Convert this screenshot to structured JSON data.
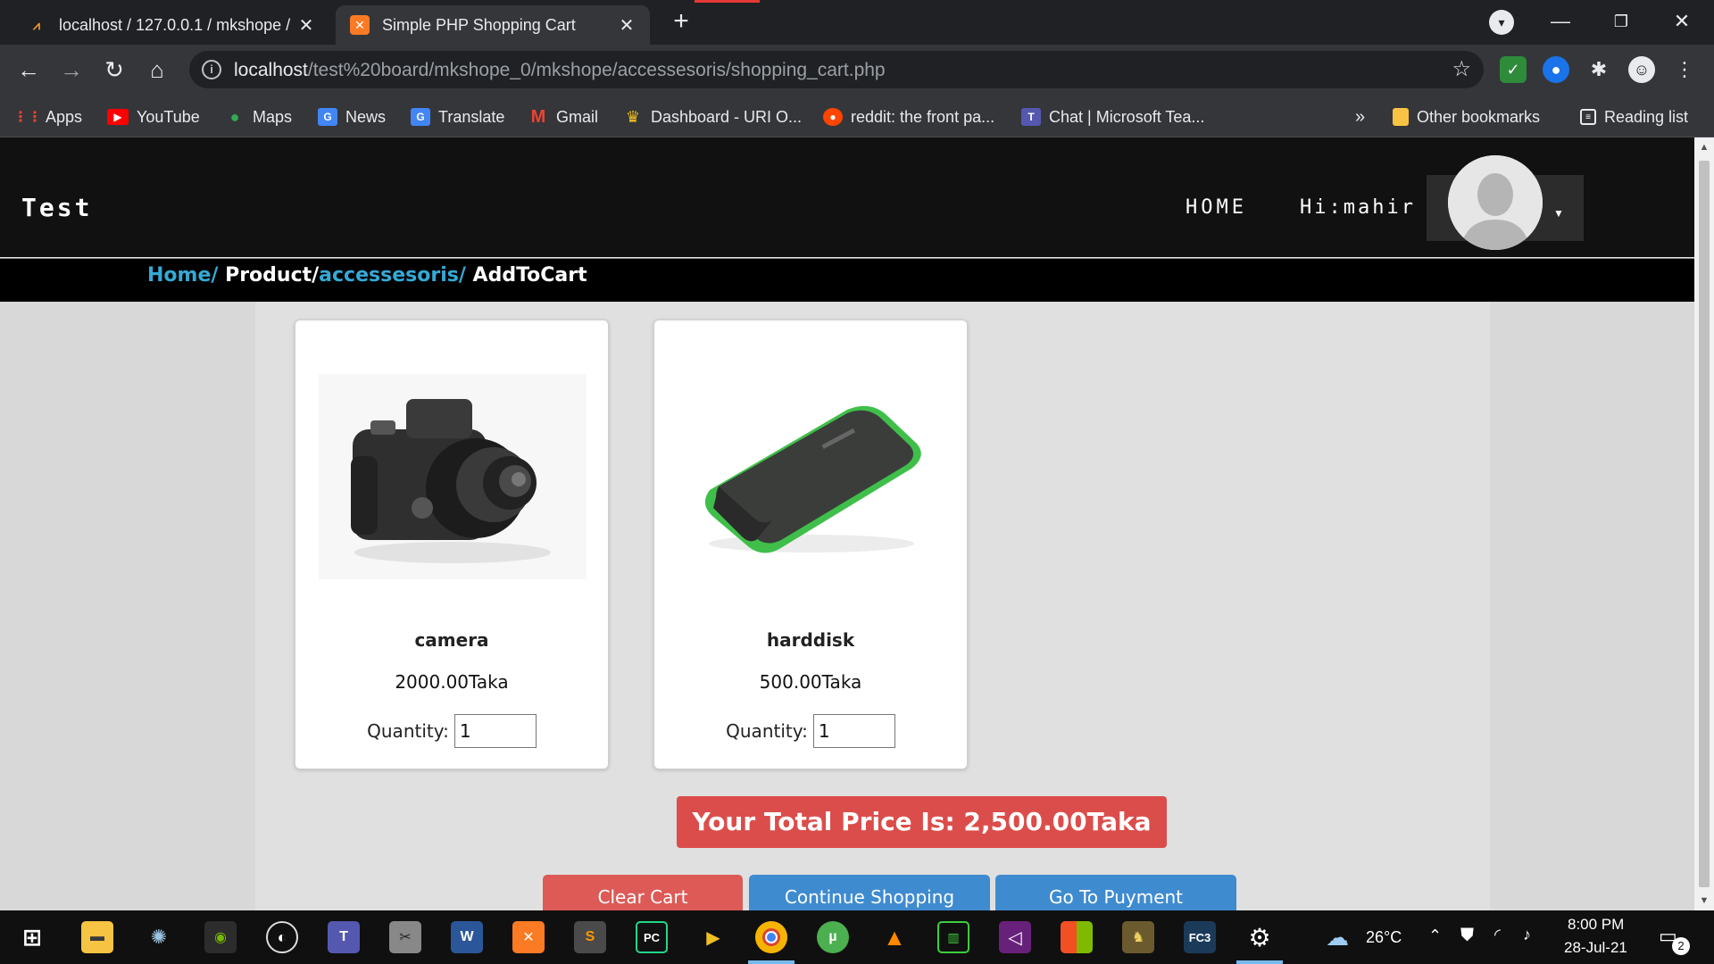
{
  "browser": {
    "tabs": [
      {
        "title": "localhost / 127.0.0.1 / mkshope /",
        "active": false
      },
      {
        "title": "Simple PHP Shopping Cart",
        "active": true
      }
    ],
    "new_tab": "+",
    "close": "✕",
    "url_host": "localhost",
    "url_path": "/test%20board/mkshope_0/mkshope/accessesoris/shopping_cart.php",
    "bookmarks": [
      {
        "label": "Apps",
        "icon": "apps-grid-icon"
      },
      {
        "label": "YouTube",
        "icon": "youtube-icon"
      },
      {
        "label": "Maps",
        "icon": "maps-pin-icon"
      },
      {
        "label": "News",
        "icon": "news-icon"
      },
      {
        "label": "Translate",
        "icon": "translate-icon"
      },
      {
        "label": "Gmail",
        "icon": "gmail-icon"
      },
      {
        "label": "Dashboard - URI O...",
        "icon": "trophy-icon"
      },
      {
        "label": "reddit: the front pa...",
        "icon": "reddit-icon"
      },
      {
        "label": "Chat | Microsoft Tea...",
        "icon": "teams-icon"
      }
    ],
    "bookmarks_overflow": "»",
    "other_bookmarks": "Other bookmarks",
    "reading_list": "Reading list"
  },
  "site": {
    "brand": "Test",
    "nav": {
      "home": "HOME",
      "user": "Hi:mahir"
    },
    "breadcrumb": {
      "home": "Home/",
      "product": "Product/",
      "category": "accessesoris/",
      "current": "AddToCart"
    }
  },
  "cart": {
    "items": [
      {
        "name": "camera",
        "price": "2000.00Taka",
        "qty_label": "Quantity:",
        "qty": "1"
      },
      {
        "name": "harddisk",
        "price": "500.00Taka",
        "qty_label": "Quantity:",
        "qty": "1"
      }
    ],
    "total": "Your Total Price Is: 2,500.00Taka",
    "buttons": {
      "clear": "Clear Cart",
      "continue": "Continue Shopping",
      "payment": "Go To Puyment"
    }
  },
  "taskbar": {
    "weather": "26°C",
    "time": "8:00 PM",
    "date": "28-Jul-21",
    "notifications": "2"
  },
  "colors": {
    "total_red": "#db4d4a",
    "button_blue": "#3f8bd0",
    "crumb_link": "#35a9d6"
  }
}
